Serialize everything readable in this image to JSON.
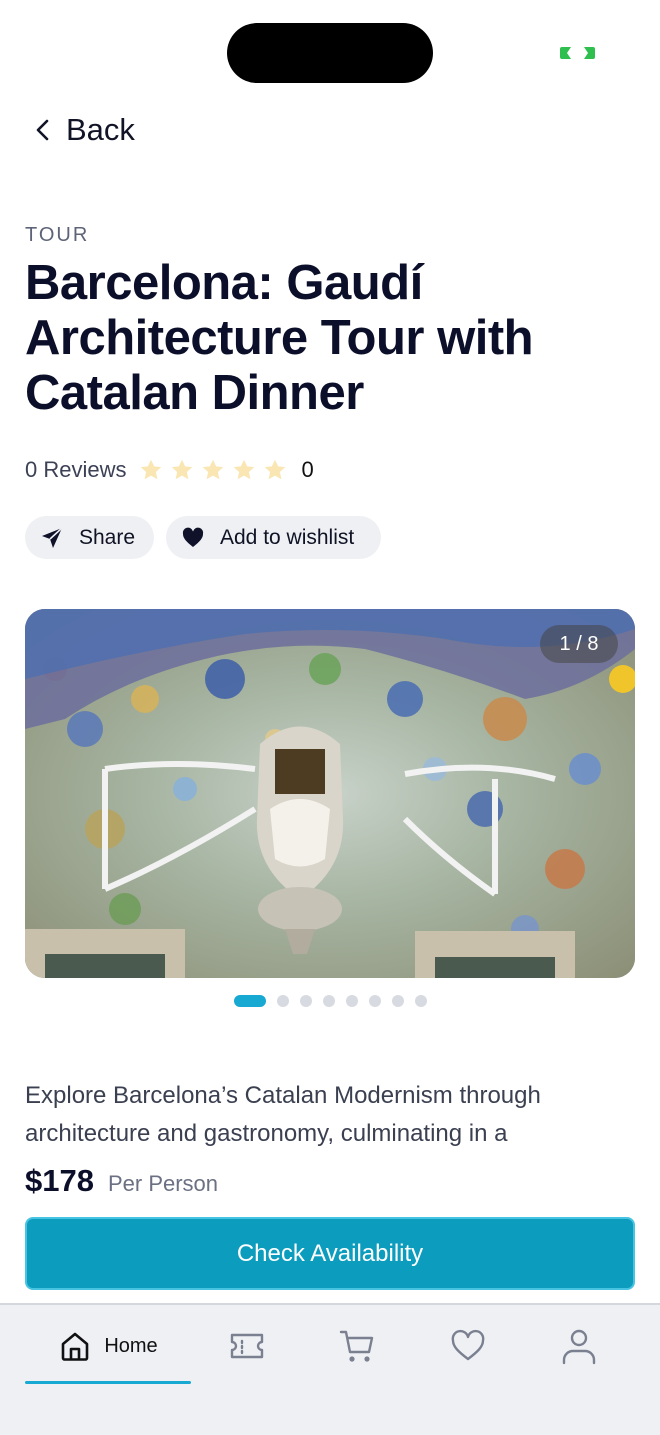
{
  "header": {
    "back_label": "Back"
  },
  "tour": {
    "category": "TOUR",
    "title": "Barcelona: Gaudí Architecture Tour with Catalan Dinner",
    "reviews_label": "0 Reviews",
    "rating_value": "0",
    "stars_total": 5,
    "share_label": "Share",
    "wishlist_label": "Add to wishlist",
    "gallery_counter": "1 / 8",
    "gallery_count": 8,
    "gallery_active_index": 1,
    "description": "Explore Barcelona’s Catalan Modernism through architecture and gastronomy, culminating in a",
    "price": "$178",
    "price_unit": "Per Person",
    "cta_label": "Check Availability"
  },
  "nav": {
    "home_label": "Home",
    "tabs": [
      "home-icon",
      "ticket-icon",
      "cart-icon",
      "heart-icon",
      "profile-icon"
    ]
  },
  "colors": {
    "accent": "#18a9d2",
    "cta": "#0c9cbd",
    "star_empty": "#f9e6b3",
    "title": "#0c0f2a"
  }
}
